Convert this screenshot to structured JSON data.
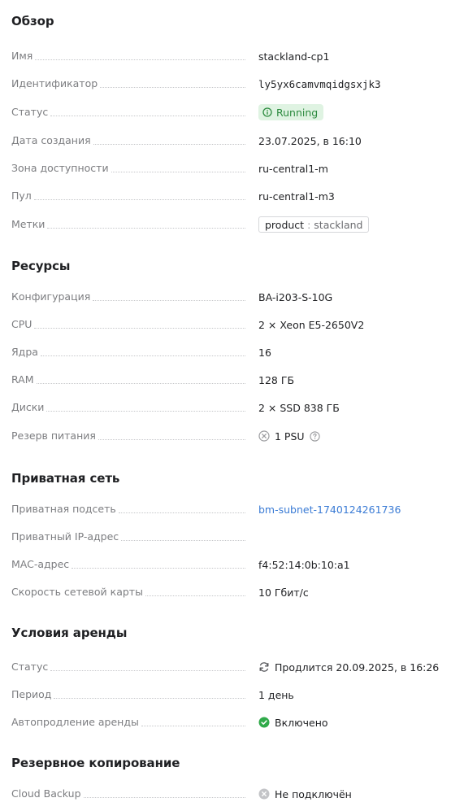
{
  "overview": {
    "title": "Обзор",
    "name": {
      "label": "Имя",
      "value": "stackland-cp1"
    },
    "id": {
      "label": "Идентификатор",
      "value": "ly5yx6camvmqidgsxjk3"
    },
    "status": {
      "label": "Статус",
      "value": "Running"
    },
    "created": {
      "label": "Дата создания",
      "value": "23.07.2025, в 16:10"
    },
    "zone": {
      "label": "Зона доступности",
      "value": "ru-central1-m"
    },
    "pool": {
      "label": "Пул",
      "value": "ru-central1-m3"
    },
    "labels": {
      "label": "Метки",
      "tag_key": "product",
      "tag_sep": ":",
      "tag_value": "stackland"
    }
  },
  "resources": {
    "title": "Ресурсы",
    "config": {
      "label": "Конфигурация",
      "value": "BA-i203-S-10G"
    },
    "cpu": {
      "label": "CPU",
      "value": "2 × Xeon E5-2650V2"
    },
    "cores": {
      "label": "Ядра",
      "value": "16"
    },
    "ram": {
      "label": "RAM",
      "value": "128 ГБ"
    },
    "disks": {
      "label": "Диски",
      "value": "2 × SSD 838 ГБ"
    },
    "power": {
      "label": "Резерв питания",
      "value": "1 PSU"
    }
  },
  "network": {
    "title": "Приватная сеть",
    "subnet": {
      "label": "Приватная подсеть",
      "value": "bm-subnet-1740124261736"
    },
    "ip": {
      "label": "Приватный IP-адрес",
      "value": ""
    },
    "mac": {
      "label": "MAC-адрес",
      "value": "f4:52:14:0b:10:a1"
    },
    "speed": {
      "label": "Скорость сетевой карты",
      "value": "10 Гбит/с"
    }
  },
  "lease": {
    "title": "Условия аренды",
    "status": {
      "label": "Статус",
      "value": "Продлится 20.09.2025, в 16:26"
    },
    "period": {
      "label": "Период",
      "value": "1 день"
    },
    "autorenew": {
      "label": "Автопродление аренды",
      "value": "Включено"
    }
  },
  "backup": {
    "title": "Резервное копирование",
    "cloud": {
      "label": "Cloud Backup",
      "value": "Не подключён"
    }
  },
  "colors": {
    "accent": "#3a7bd5",
    "success": "#2b8a3e",
    "success_bg": "#dff3e2",
    "muted": "#7c7d80"
  }
}
